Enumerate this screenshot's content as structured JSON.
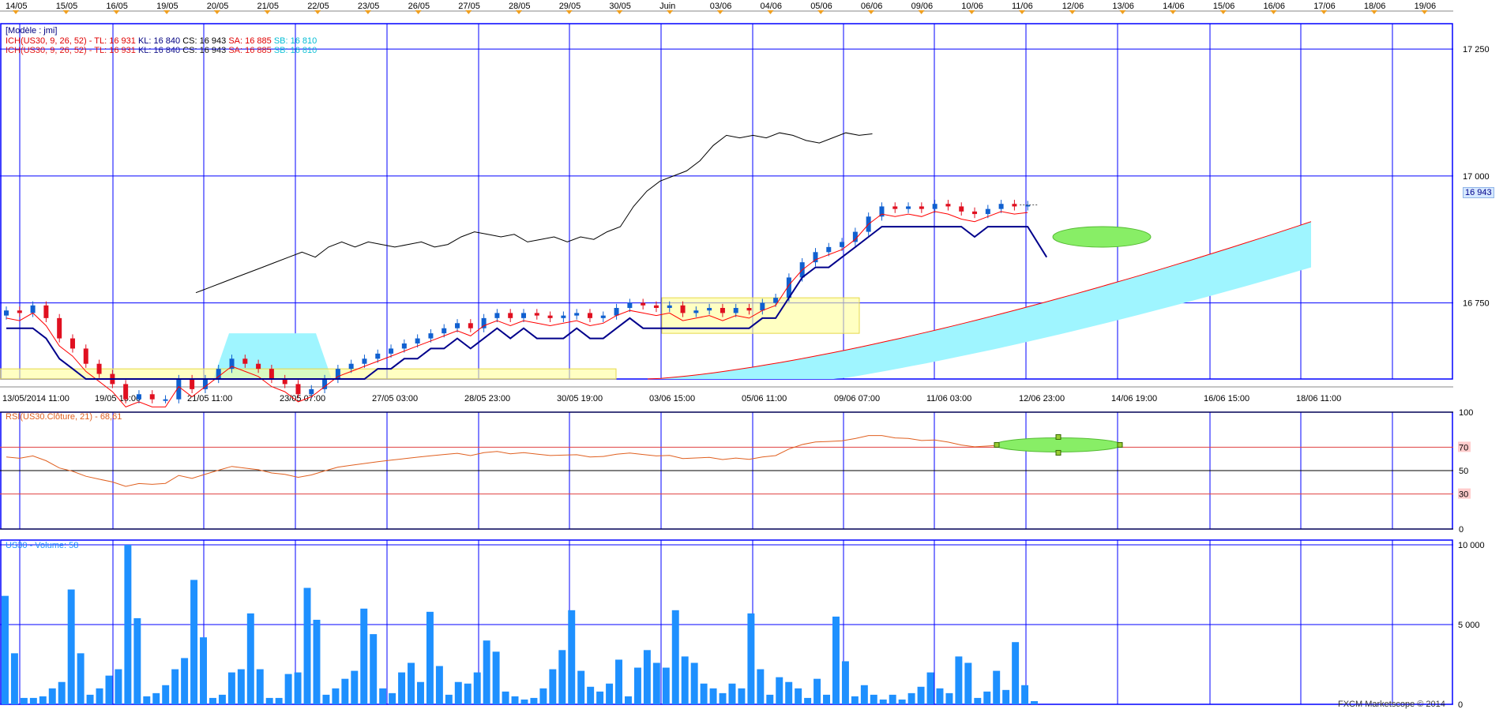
{
  "top_dates": [
    "14/05",
    "15/05",
    "16/05",
    "19/05",
    "20/05",
    "21/05",
    "22/05",
    "23/05",
    "26/05",
    "27/05",
    "28/05",
    "29/05",
    "30/05",
    "Juin",
    "03/06",
    "04/06",
    "05/06",
    "06/06",
    "09/06",
    "10/06",
    "11/06",
    "12/06",
    "13/06",
    "14/06",
    "15/06",
    "16/06",
    "17/06",
    "18/06",
    "19/06"
  ],
  "bottom_dates": [
    "13/05/2014 11:00",
    "19/05 15:00",
    "21/05 11:00",
    "23/05 07:00",
    "27/05 03:00",
    "28/05 23:00",
    "30/05 19:00",
    "03/06 15:00",
    "05/06 11:00",
    "09/06 07:00",
    "11/06 03:00",
    "12/06 23:00",
    "14/06 19:00",
    "16/06 15:00",
    "18/06 11:00"
  ],
  "main_panel": {
    "model_label": "[Modèle : jmi]",
    "ich_label": "ICH(US30, 9, 26, 52) -",
    "tl_label": "TL: 16 931",
    "kl_label": "KL: 16 840",
    "cs_label": "CS: 16 943",
    "sa_label": "SA: 16 885",
    "sb_label": "SB: 16 810",
    "price_badge": "16 943",
    "y_ticks": [
      "17 250",
      "17 000",
      "16 750"
    ]
  },
  "rsi_panel": {
    "label": "RSI(US30.Clôture, 21) - 68,61",
    "y_ticks": [
      "100",
      "70",
      "50",
      "30",
      "0"
    ]
  },
  "volume_panel": {
    "label": "US30 - Volume: 58",
    "y_ticks": [
      "10 000",
      "5 000",
      "0"
    ],
    "footer": "FXCM Marketscope © 2014"
  },
  "colors": {
    "grid": "#0000ff",
    "tenkan": "#ff0000",
    "kijun": "#00008b",
    "chikou": "#000000",
    "cloud": "#9ff5ff",
    "rsi": "#e06020",
    "volume": "#1e90ff",
    "bull": "#1060d0",
    "bear": "#e01020"
  },
  "chart_data": {
    "type": "candlestick",
    "instrument": "US30",
    "closes": [
      16735,
      16730,
      16745,
      16720,
      16680,
      16660,
      16630,
      16610,
      16590,
      16560,
      16570,
      16560,
      16560,
      16600,
      16580,
      16600,
      16620,
      16640,
      16630,
      16620,
      16600,
      16590,
      16570,
      16580,
      16600,
      16620,
      16630,
      16640,
      16650,
      16660,
      16670,
      16680,
      16690,
      16700,
      16710,
      16700,
      16720,
      16730,
      16720,
      16730,
      16725,
      16720,
      16725,
      16730,
      16720,
      16725,
      16740,
      16750,
      16745,
      16740,
      16745,
      16730,
      16735,
      16740,
      16730,
      16740,
      16735,
      16750,
      16760,
      16800,
      16830,
      16850,
      16860,
      16870,
      16890,
      16920,
      16940,
      16935,
      16940,
      16935,
      16945,
      16940,
      16930,
      16925,
      16935,
      16945,
      16940,
      16943
    ],
    "volume": [
      6800,
      3200,
      400,
      400,
      500,
      1000,
      1400,
      7200,
      3200,
      600,
      1000,
      1800,
      2200,
      10000,
      5400,
      500,
      700,
      1200,
      2200,
      2900,
      7800,
      4200,
      400,
      600,
      2000,
      2200,
      5700,
      2200,
      400,
      400,
      1900,
      2000,
      7300,
      5300,
      600,
      1000,
      1600,
      2100,
      6000,
      4400,
      1000,
      700,
      2000,
      2600,
      1400,
      5800,
      2400,
      600,
      1400,
      1300,
      2000,
      4000,
      3300,
      800,
      500,
      300,
      400,
      1000,
      2200,
      3400,
      5900,
      2100,
      1100,
      800,
      1300,
      2800,
      500,
      2300,
      3400,
      2600,
      2300,
      5900,
      3000,
      2600,
      1300,
      1000,
      700,
      1300,
      1000,
      5700,
      2200,
      600,
      1700,
      1400,
      1000,
      400,
      1600,
      600,
      5500,
      2700,
      500,
      1200,
      600,
      300,
      600,
      300,
      700,
      1100,
      2000,
      1000,
      700,
      3000,
      2600,
      400,
      800,
      2100,
      900,
      3900,
      1200,
      200
    ],
    "rsi_last": 68.61,
    "tenkan": 16931,
    "kijun": 16840,
    "chikou": 16943,
    "senkou_a": 16885,
    "senkou_b": 16810
  }
}
